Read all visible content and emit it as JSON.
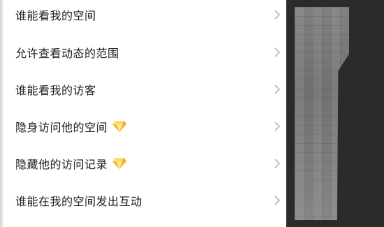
{
  "menu": {
    "items": [
      {
        "label": "谁能看我的空间",
        "vip": false
      },
      {
        "label": "允许查看动态的范围",
        "vip": false
      },
      {
        "label": "谁能看我的访客",
        "vip": false
      },
      {
        "label": "隐身访问他的空间",
        "vip": true
      },
      {
        "label": "隐藏他的访问记录",
        "vip": true
      },
      {
        "label": "谁能在我的空间发出互动",
        "vip": false
      }
    ]
  },
  "icons": {
    "chevron": "chevron-right-icon",
    "vip": "diamond-icon"
  },
  "colors": {
    "panel": "#ffffff",
    "text": "#1e1e1e",
    "chevron": "#b5b5b5",
    "diamond_light": "#ffe27a",
    "diamond_dark": "#f0a81c",
    "backdrop": "#2b2b2b"
  }
}
